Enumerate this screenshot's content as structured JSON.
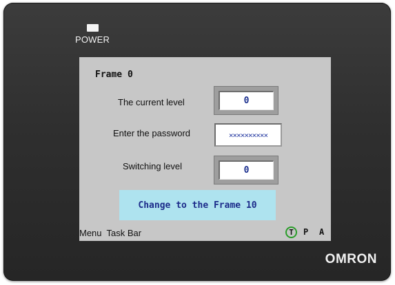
{
  "device": {
    "power_label": "POWER",
    "brand": "OMRON"
  },
  "screen": {
    "frame_title": "Frame 0",
    "fields": [
      {
        "label": "The current level",
        "value": "0"
      },
      {
        "label": "Enter the password",
        "value": "××××××××××"
      },
      {
        "label": "Switching level",
        "value": "0"
      }
    ],
    "change_button_label": "Change to the Frame 10",
    "taskbar": {
      "menu_label": "Menu  Task Bar",
      "mode_t": "T",
      "mode_p": "P",
      "mode_a": "A"
    }
  },
  "colors": {
    "screen_bg": "#c7c7c7",
    "button_bg": "#aee3ef",
    "value_text": "#1b2f8e",
    "mode_active_ring": "#2a9d2a"
  }
}
